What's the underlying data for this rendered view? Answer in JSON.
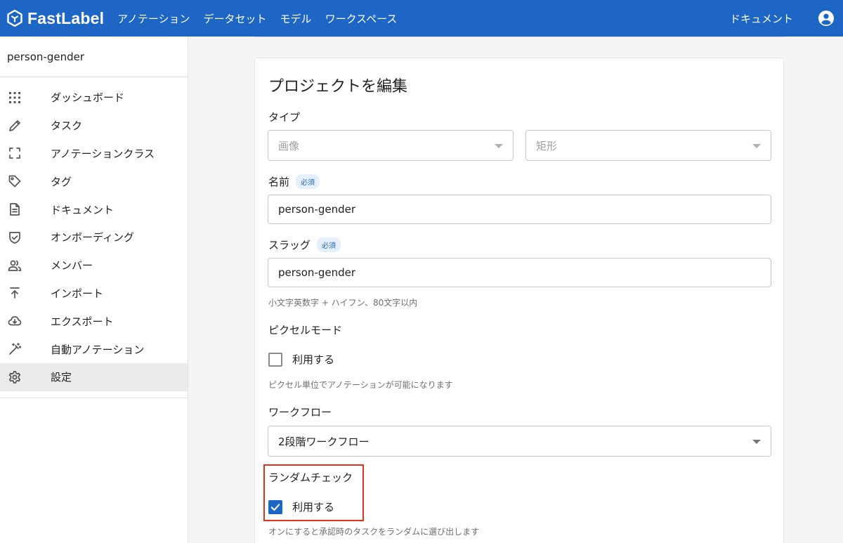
{
  "app": {
    "brand": "FastLabel",
    "nav": [
      "アノテーション",
      "データセット",
      "モデル",
      "ワークスペース"
    ],
    "docs_link": "ドキュメント",
    "colors": {
      "primary": "#1e66c5",
      "highlight": "#e3321c"
    }
  },
  "sidebar": {
    "project_name": "person-gender",
    "items": [
      {
        "label": "ダッシュボード",
        "icon": "grid-icon"
      },
      {
        "label": "タスク",
        "icon": "pencil-icon"
      },
      {
        "label": "アノテーションクラス",
        "icon": "crop-frame-icon"
      },
      {
        "label": "タグ",
        "icon": "tag-icon"
      },
      {
        "label": "ドキュメント",
        "icon": "document-icon"
      },
      {
        "label": "オンボーディング",
        "icon": "shield-check-icon"
      },
      {
        "label": "メンバー",
        "icon": "people-icon"
      },
      {
        "label": "インポート",
        "icon": "upload-icon"
      },
      {
        "label": "エクスポート",
        "icon": "cloud-download-icon"
      },
      {
        "label": "自動アノテーション",
        "icon": "magic-wand-icon"
      },
      {
        "label": "設定",
        "icon": "gear-icon",
        "active": true
      }
    ]
  },
  "form": {
    "title": "プロジェクトを編集",
    "type_label": "タイプ",
    "type_value": "画像",
    "shape_value": "矩形",
    "name_label": "名前",
    "required_badge": "必須",
    "name_value": "person-gender",
    "slug_label": "スラッグ",
    "slug_value": "person-gender",
    "slug_hint": "小文字英数字 + ハイフン、80文字以内",
    "pixel_mode_label": "ピクセルモード",
    "pixel_mode_checkbox": "利用する",
    "pixel_mode_checked": false,
    "pixel_mode_hint": "ピクセル単位でアノテーションが可能になります",
    "workflow_label": "ワークフロー",
    "workflow_value": "2段階ワークフロー",
    "random_check_label": "ランダムチェック",
    "random_check_checkbox": "利用する",
    "random_check_checked": true,
    "random_check_hint": "オンにすると承認時のタスクをランダムに選び出します"
  }
}
